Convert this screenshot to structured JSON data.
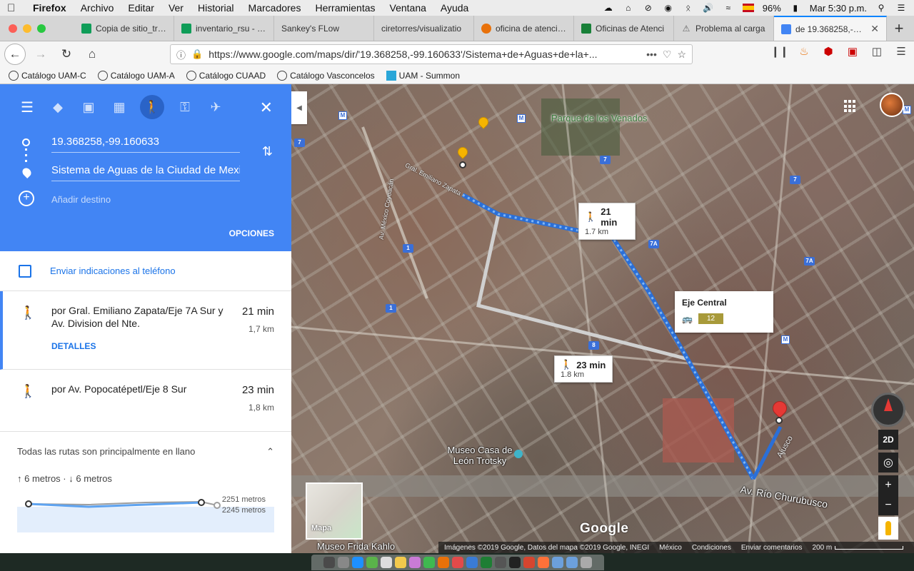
{
  "menubar": {
    "app": "Firefox",
    "items": [
      "Archivo",
      "Editar",
      "Ver",
      "Historial",
      "Marcadores",
      "Herramientas",
      "Ventana",
      "Ayuda"
    ],
    "battery": "96%",
    "clock": "Mar 5:30 p.m."
  },
  "tabs": [
    {
      "title": "Copia de sitio_tran",
      "color": "#0f9d58"
    },
    {
      "title": "inventario_rsu - He",
      "color": "#0f9d58"
    },
    {
      "title": "Sankey's FLow",
      "color": "#d6d6d6"
    },
    {
      "title": "ciretorres/visualizatio",
      "color": "#d6d6d6"
    },
    {
      "title": "oficina de atención",
      "color": "#e8710a"
    },
    {
      "title": "Oficinas de Atenci",
      "color": "#188038"
    },
    {
      "title": "Problema al carga",
      "color": "#666666"
    },
    {
      "title": "de 19.368258,-99.16",
      "color": "#4285f4"
    }
  ],
  "navbar": {
    "url": "https://www.google.com/maps/dir/'19.368258,-99.160633'/Sistema+de+Aguas+de+la+..."
  },
  "bookmarks": [
    {
      "label": "Catálogo UAM-C",
      "icon": "globe-icon"
    },
    {
      "label": "Catálogo UAM-A",
      "icon": "globe-icon"
    },
    {
      "label": "Catálogo CUAAD",
      "icon": "globe-icon"
    },
    {
      "label": "Catálogo Vasconcelos",
      "icon": "globe-icon"
    },
    {
      "label": "UAM - Summon",
      "icon": "uam-icon"
    }
  ],
  "directions": {
    "origin": "19.368258,-99.160633",
    "destination": "Sistema de Aguas de la Ciudad de Mexico",
    "add_destination": "Añadir destino",
    "options": "OPCIONES",
    "send_to_phone": "Enviar indicaciones al teléfono",
    "routes": [
      {
        "via": "por Gral. Emiliano Zapata/Eje 7A Sur y Av. Division del Nte.",
        "time": "21 min",
        "distance": "1,7 km",
        "details": "DETALLES"
      },
      {
        "via": "por Av. Popocatépetl/Eje 8 Sur",
        "time": "23 min",
        "distance": "1,8 km"
      }
    ],
    "elevation": {
      "title": "Todas las rutas son principalmente en llano",
      "up_down": "↑ 6 metros · ↓ 6 metros",
      "max_label": "2251 metros",
      "min_label": "2245 metros"
    }
  },
  "map": {
    "park": "Parque de los Venados",
    "route_cards": [
      {
        "time": "21 min",
        "distance": "1.7 km"
      },
      {
        "time": "23 min",
        "distance": "1.8 km"
      }
    ],
    "transit": {
      "name": "Eje Central",
      "line": "12"
    },
    "museum_trotsky": "Museo Casa de León Trotsky",
    "museum_frida": "Museo Frida Kahlo",
    "road_churubusco": "Av. Río Churubusco",
    "street_zapata": "Gral. Emiliano Zapata",
    "street_mexico_coyoacan": "Av. México Coyoacán",
    "street_ajusco": "Ajusco",
    "minimap_label": "Mapa",
    "tilt_label": "2D",
    "logo": "Google",
    "attribution": [
      "Imágenes ©2019 Google, Datos del mapa ©2019 Google, INEGI",
      "México",
      "Condiciones",
      "Enviar comentarios"
    ],
    "scale": "200 m",
    "shields": [
      "7",
      "7",
      "7A",
      "7A",
      "7",
      "1",
      "1",
      "8"
    ],
    "metro": [
      "M",
      "M",
      "M",
      "M"
    ]
  },
  "colors": {
    "maps_blue": "#4285f4",
    "link_blue": "#1a73e8",
    "route_light_blue": "#5ea3f0"
  }
}
